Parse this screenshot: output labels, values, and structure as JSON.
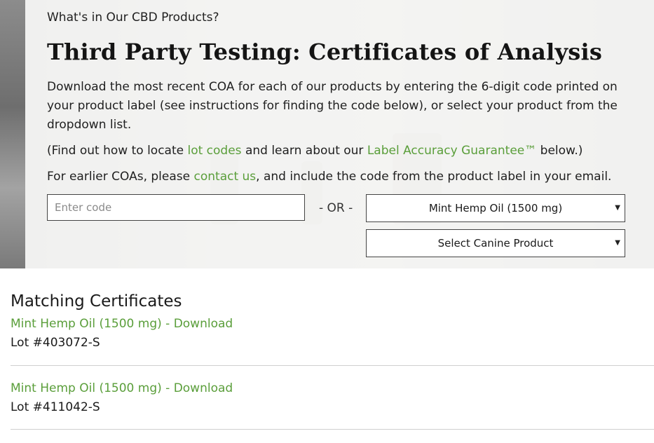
{
  "hero": {
    "eyebrow": "What's in Our CBD Products?",
    "title": "Third Party Testing: Certificates of Analysis",
    "intro": "Download the most recent COA for each of our products by entering the 6-digit code printed on your product label (see instructions for finding the code below), or select your product from the dropdown list.",
    "lot_line": {
      "prefix": "(Find out how to locate ",
      "lot_link": "lot codes",
      "middle": " and learn about our ",
      "guarantee_link": "Label Accuracy Guarantee™",
      "suffix": " below.)"
    },
    "contact_line": {
      "prefix": "For earlier COAs, please ",
      "contact_link": "contact us",
      "suffix": ", and include the code from the product label in your email."
    }
  },
  "search": {
    "code_placeholder": "Enter code",
    "or_label": "- OR -",
    "product_select": "Mint Hemp Oil (1500 mg)",
    "canine_select": "Select Canine Product"
  },
  "results": {
    "title": "Matching Certificates",
    "items": [
      {
        "link": "Mint Hemp Oil (1500 mg) - Download",
        "lot": "Lot #403072-S"
      },
      {
        "link": "Mint Hemp Oil (1500 mg) - Download",
        "lot": "Lot #411042-S"
      }
    ]
  },
  "colors": {
    "link_green": "#5a9e3a",
    "text": "#1a1a1a"
  }
}
